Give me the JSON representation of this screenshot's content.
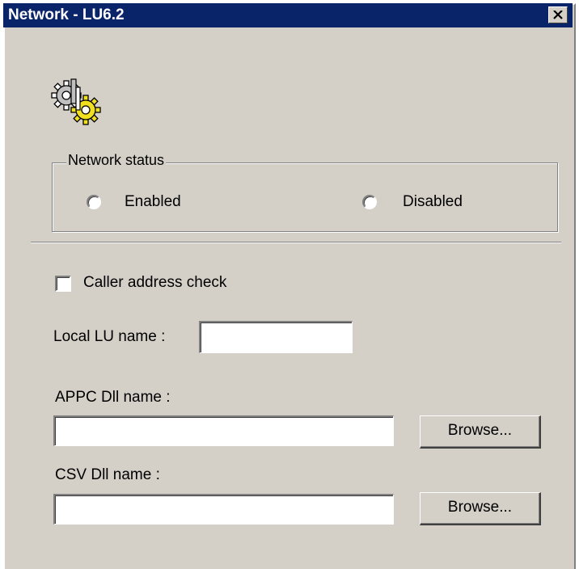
{
  "window": {
    "title": "Network - LU6.2",
    "close_glyph": "✕"
  },
  "network_status": {
    "legend": "Network status",
    "enabled_label": "Enabled",
    "disabled_label": "Disabled",
    "selected": null
  },
  "caller_check": {
    "label": "Caller address check",
    "checked": false
  },
  "local_lu": {
    "label": "Local LU name :",
    "value": ""
  },
  "appc": {
    "label": "APPC Dll name :",
    "value": "",
    "browse_label": "Browse..."
  },
  "csv": {
    "label": "CSV Dll name :",
    "value": "",
    "browse_label": "Browse..."
  },
  "icons": {
    "header_icon": "gears-icon"
  },
  "colors": {
    "titlebar": "#0a246a",
    "face": "#d4d0c8",
    "gear_yellow": "#f0e020"
  }
}
